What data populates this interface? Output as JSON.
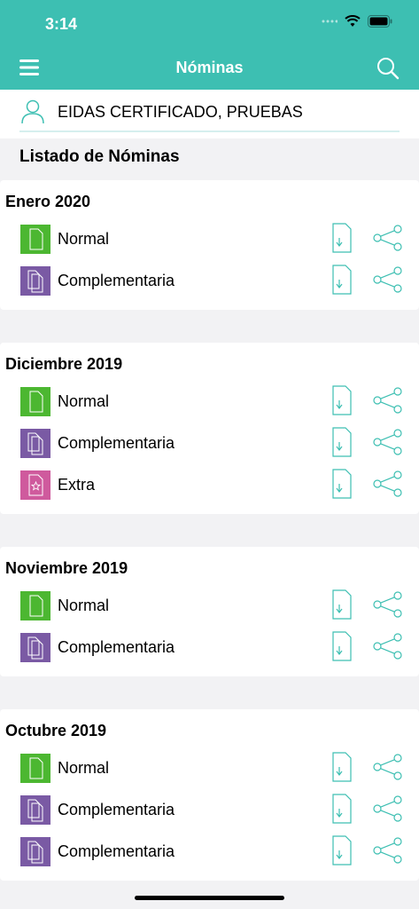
{
  "status_bar": {
    "time": "3:14"
  },
  "header": {
    "title": "Nóminas"
  },
  "user": {
    "name": "EIDAS CERTIFICADO, PRUEBAS"
  },
  "list_title": "Listado de Nóminas",
  "colors": {
    "accent": "#3dbfb2",
    "normal": "#4cb731",
    "complementaria": "#7a5aa4",
    "extra": "#cf5a9d"
  },
  "sections": [
    {
      "title": "Enero 2020",
      "items": [
        {
          "label": "Normal",
          "type": "normal"
        },
        {
          "label": "Complementaria",
          "type": "complementaria"
        }
      ]
    },
    {
      "title": "Diciembre 2019",
      "items": [
        {
          "label": "Normal",
          "type": "normal"
        },
        {
          "label": "Complementaria",
          "type": "complementaria"
        },
        {
          "label": "Extra",
          "type": "extra"
        }
      ]
    },
    {
      "title": "Noviembre 2019",
      "items": [
        {
          "label": "Normal",
          "type": "normal"
        },
        {
          "label": "Complementaria",
          "type": "complementaria"
        }
      ]
    },
    {
      "title": "Octubre 2019",
      "items": [
        {
          "label": "Normal",
          "type": "normal"
        },
        {
          "label": "Complementaria",
          "type": "complementaria"
        },
        {
          "label": "Complementaria",
          "type": "complementaria"
        }
      ]
    }
  ]
}
